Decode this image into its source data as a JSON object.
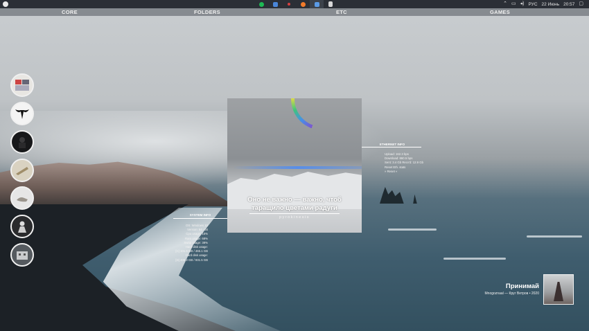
{
  "taskbar": {
    "apps": [
      {
        "name": "spotify-icon",
        "color": "#1db954"
      },
      {
        "name": "finder-icon",
        "color": "#4a86d8"
      },
      {
        "name": "app-red-icon",
        "color": "#d84040"
      },
      {
        "name": "firefox-icon",
        "color": "#f07a2a"
      },
      {
        "name": "folder-icon",
        "color": "#5b9be6"
      },
      {
        "name": "document-icon",
        "color": "#d8d8d8"
      }
    ],
    "tray": {
      "language": "РУС",
      "date": "22 Июнь",
      "time": "20:57"
    }
  },
  "sections": {
    "core": "CORE",
    "folders": "FOLDERS",
    "etc": "ETC",
    "games": "GAMES"
  },
  "artwork": {
    "quote_line1": "Оно не важно — важно, чтоб",
    "quote_line2": "таращило цветами радуги",
    "subtitle": "pyrokinesis"
  },
  "system_info": {
    "title": "SYSTEM INFO",
    "lines": [
      "OS: Windows 10",
      "Version: 64 - bit",
      "Cpu usage: 15%",
      "Ram usage: 68%",
      "Swap usage: 38%",
      "Hard disk usage:",
      "[C] 101.6 GB / 465.1 GB",
      "Hard disk usage:",
      "[D] 408.2 GB / 931.5 GB"
    ]
  },
  "ethernet_info": {
    "title": "ETHERNET INFO",
    "lines": [
      "Upload: 162.3 bps",
      "Download: 860.5 bps",
      "Sent: 3.4 Gb  Recv'd: 12.9 Gb",
      "Reset Eth. stats",
      "» Reset «"
    ]
  },
  "now_playing": {
    "title": "Принимай",
    "subtitle": "Mnogoznaal — Круг Ветров • 2020"
  }
}
